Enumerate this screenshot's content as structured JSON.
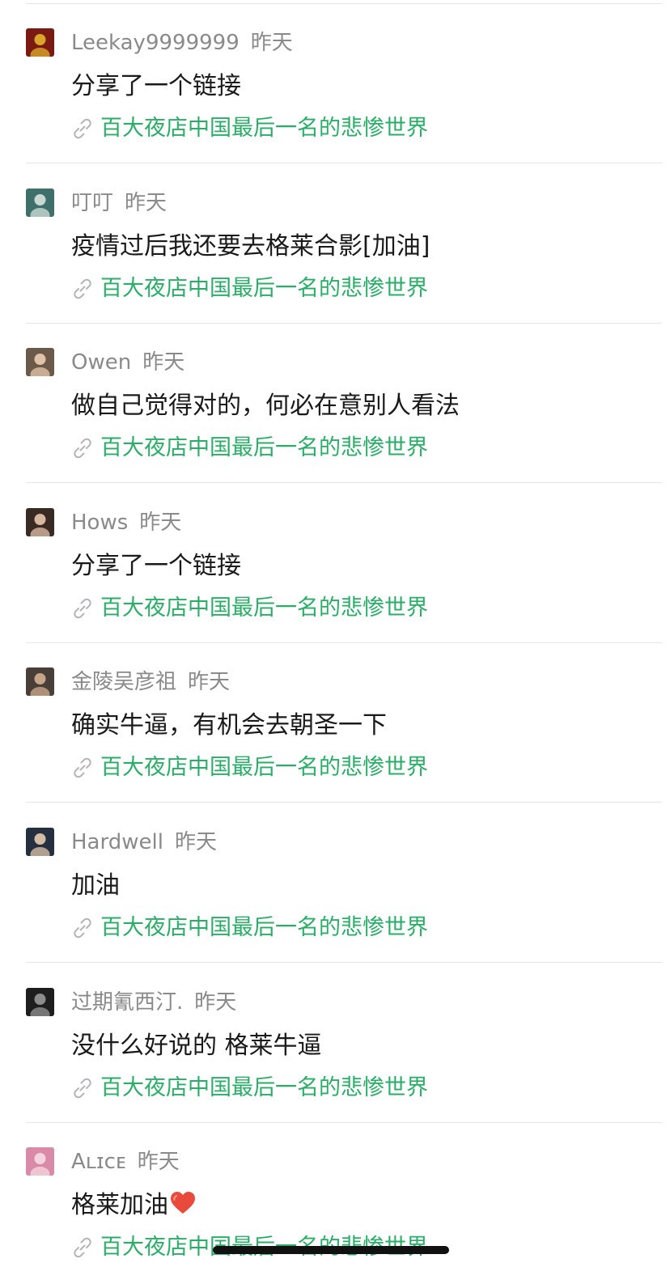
{
  "items": [
    {
      "name": "Leekay9999999",
      "time": "昨天",
      "comment": "分享了一个链接",
      "link": "百大夜店中国最后一名的悲惨世界",
      "avatar": {
        "bg": "#7a1a12",
        "fg": "#d9a52b"
      }
    },
    {
      "name": "叮叮",
      "time": "昨天",
      "comment": "疫情过后我还要去格莱合影[加油]",
      "link": "百大夜店中国最后一名的悲惨世界",
      "avatar": {
        "bg": "#3f6f6a",
        "fg": "#c9d8d3"
      }
    },
    {
      "name": "Owen",
      "time": "昨天",
      "comment": "做自己觉得对的，何必在意别人看法",
      "link": "百大夜店中国最后一名的悲惨世界",
      "avatar": {
        "bg": "#6b5a4a",
        "fg": "#e0c2a6"
      }
    },
    {
      "name": "Hows",
      "time": "昨天",
      "comment": "分享了一个链接",
      "link": "百大夜店中国最后一名的悲惨世界",
      "avatar": {
        "bg": "#3a2a24",
        "fg": "#d7b7a0"
      }
    },
    {
      "name": "金陵吴彦祖",
      "time": "昨天",
      "comment": "确实牛逼，有机会去朝圣一下",
      "link": "百大夜店中国最后一名的悲惨世界",
      "avatar": {
        "bg": "#4a3e38",
        "fg": "#c7a58a"
      }
    },
    {
      "name": "Hardwell",
      "time": "昨天",
      "comment": "加油",
      "link": "百大夜店中国最后一名的悲惨世界",
      "avatar": {
        "bg": "#243040",
        "fg": "#d4bca4"
      }
    },
    {
      "name": "过期氰西汀.",
      "time": "昨天",
      "comment": "没什么好说的 格莱牛逼",
      "link": "百大夜店中国最后一名的悲惨世界",
      "avatar": {
        "bg": "#1e1e1e",
        "fg": "#8c8c8c"
      }
    },
    {
      "name": "Aʟɪᴄᴇ",
      "time": "昨天",
      "comment": "格莱加油",
      "link": "百大夜店中国最后一名的悲惨世界",
      "avatar": {
        "bg": "#d98aa8",
        "fg": "#f4d3df"
      }
    }
  ],
  "colors": {
    "link": "#2aae67",
    "meta": "#8a8a8a",
    "text": "#1a1a1a",
    "divider": "#e6e6e6",
    "heart": "#e84a3c"
  },
  "icons": {
    "link": "link-icon",
    "heart": "heart-emoji-icon"
  }
}
